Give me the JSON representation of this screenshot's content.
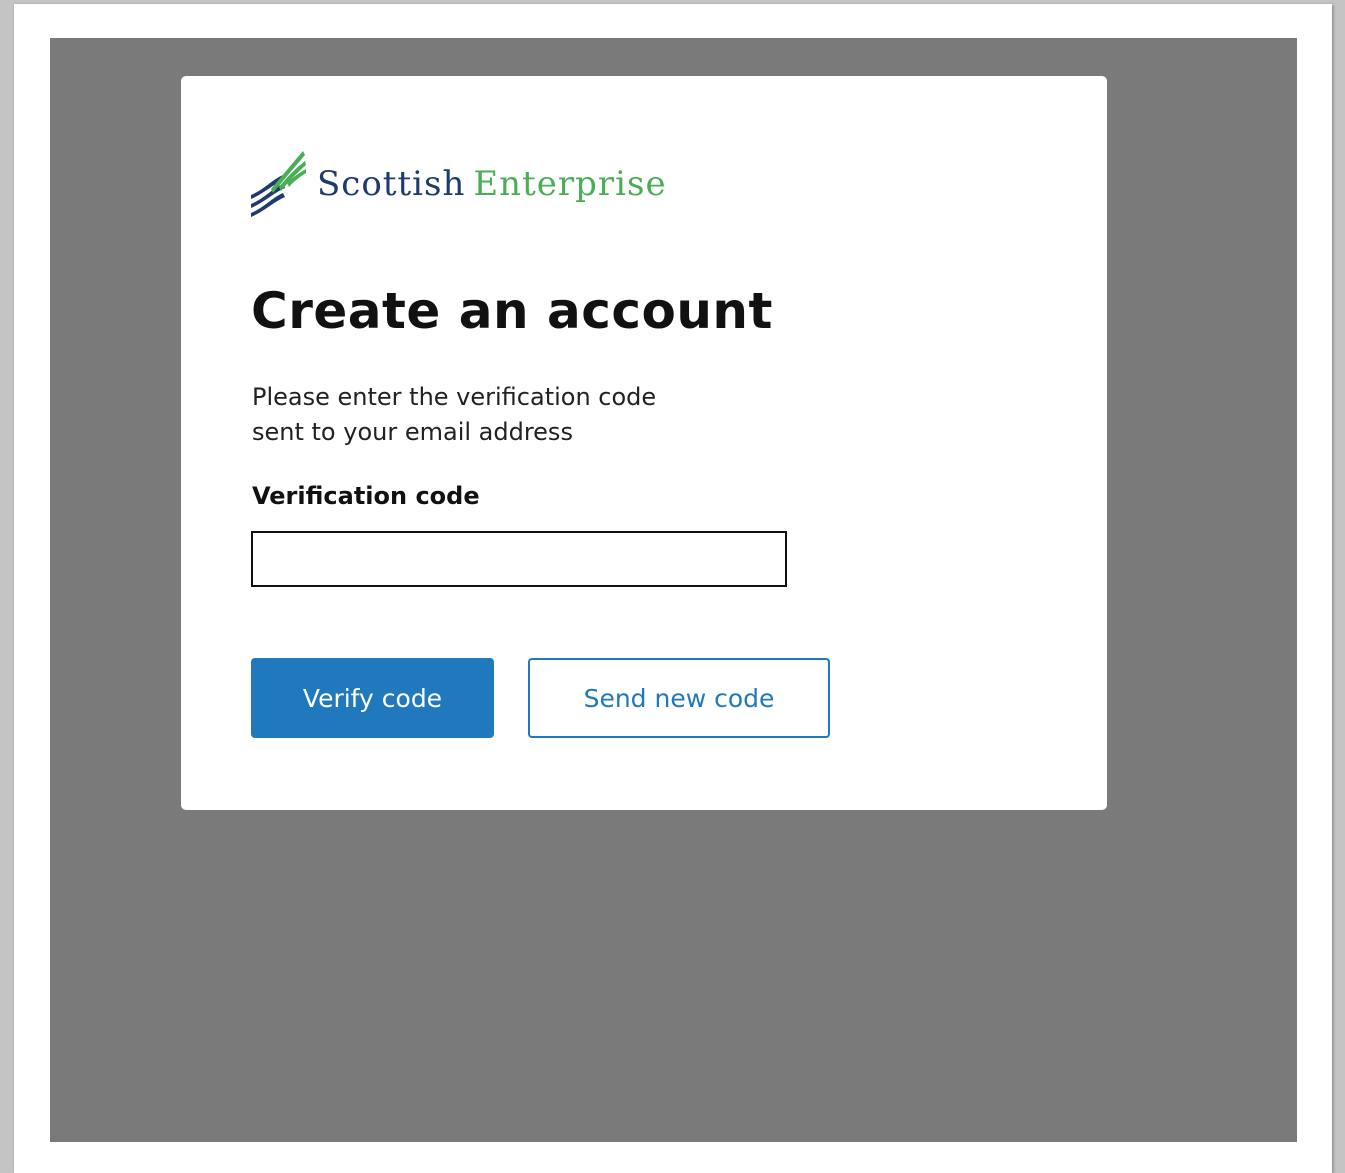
{
  "logo": {
    "word_1": "Scottish",
    "word_2": "Enterprise",
    "colors": {
      "primary": "#1e3a6e",
      "secondary": "#4aae56"
    }
  },
  "page": {
    "title": "Create an account",
    "instructions": {
      "line_1": "Please enter the verification code",
      "line_2": "sent to your email address"
    }
  },
  "form": {
    "verification_label": "Verification code",
    "verification_value": "",
    "verification_placeholder": ""
  },
  "buttons": {
    "verify_label": "Verify code",
    "resend_label": "Send new code"
  },
  "theme": {
    "accent": "#2179bd",
    "backdrop": "#7a7a7a"
  }
}
